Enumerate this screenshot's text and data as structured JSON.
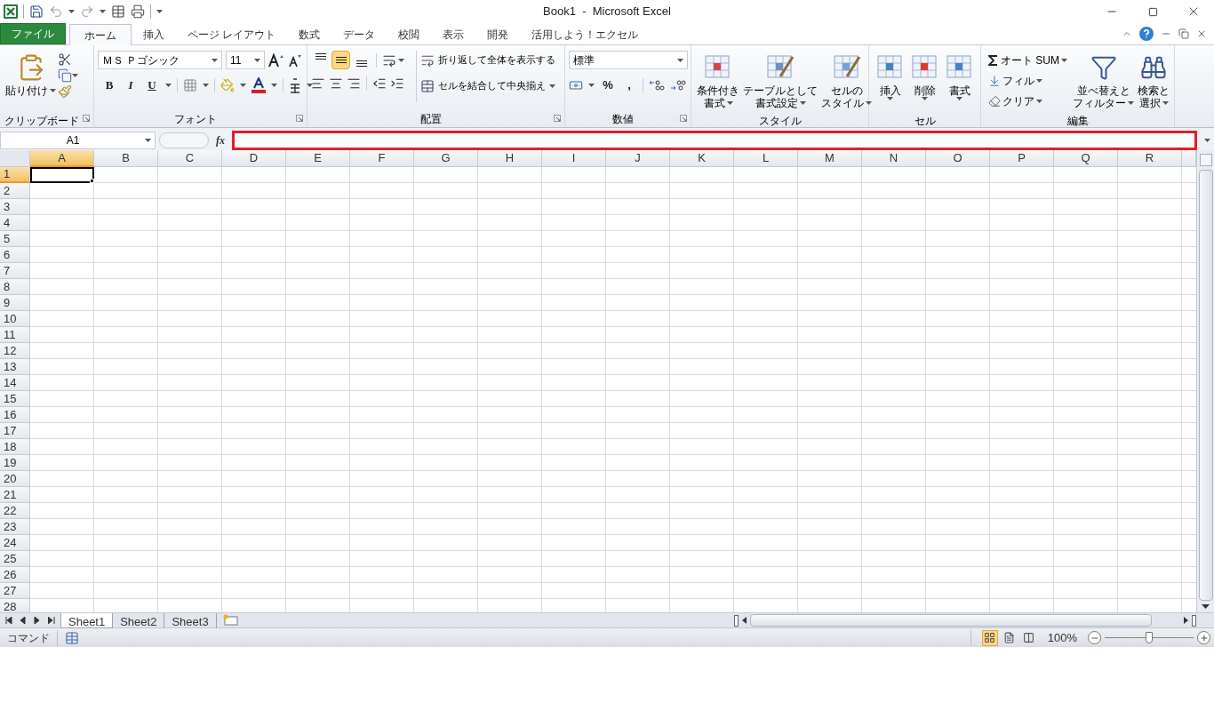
{
  "window": {
    "title": "Book1  -  Microsoft Excel"
  },
  "tabs": [
    {
      "label": "ファイル",
      "kind": "file",
      "selected": false
    },
    {
      "label": "ホーム",
      "kind": "tab",
      "selected": true
    },
    {
      "label": "挿入",
      "kind": "tab",
      "selected": false
    },
    {
      "label": "ページ レイアウト",
      "kind": "tab",
      "selected": false
    },
    {
      "label": "数式",
      "kind": "tab",
      "selected": false
    },
    {
      "label": "データ",
      "kind": "tab",
      "selected": false
    },
    {
      "label": "校閲",
      "kind": "tab",
      "selected": false
    },
    {
      "label": "表示",
      "kind": "tab",
      "selected": false
    },
    {
      "label": "開発",
      "kind": "tab",
      "selected": false
    },
    {
      "label": "活用しよう！エクセル",
      "kind": "tab",
      "selected": false
    }
  ],
  "ribbon": {
    "clipboard": {
      "label": "クリップボード",
      "paste": "貼り付け"
    },
    "font": {
      "label": "フォント",
      "font_name": "ＭＳ Ｐゴシック",
      "font_size": "11",
      "styles": [
        "B",
        "I",
        "U"
      ]
    },
    "alignment": {
      "label": "配置",
      "vertical": [
        {
          "selected": false
        },
        {
          "selected": true
        },
        {
          "selected": false
        }
      ],
      "wrap": "折り返して全体を表示する",
      "merge": "セルを結合して中央揃え"
    },
    "number": {
      "label": "数値",
      "format": "標準",
      "symbols": [
        "%",
        ","
      ]
    },
    "styles": {
      "label": "スタイル",
      "buttons": [
        {
          "lines": [
            "条件付き",
            "書式"
          ],
          "kind": "conditional"
        },
        {
          "lines": [
            "テーブルとして",
            "書式設定"
          ],
          "kind": "table"
        },
        {
          "lines": [
            "セルの",
            "スタイル"
          ],
          "kind": "cellstyle"
        }
      ]
    },
    "cells": {
      "label": "セル",
      "buttons": [
        {
          "label": "挿入",
          "kind": "insert"
        },
        {
          "label": "削除",
          "kind": "delete"
        },
        {
          "label": "書式",
          "kind": "format"
        }
      ]
    },
    "editing": {
      "label": "編集",
      "small": [
        {
          "label": "オート SUM",
          "kind": "sum"
        },
        {
          "label": "フィル",
          "kind": "fill"
        },
        {
          "label": "クリア",
          "kind": "clear"
        }
      ],
      "big": [
        {
          "lines": [
            "並べ替えと",
            "フィルター"
          ],
          "kind": "sort"
        },
        {
          "lines": [
            "検索と",
            "選択"
          ],
          "kind": "find"
        }
      ]
    }
  },
  "formula_bar": {
    "name_box": "A1",
    "fx": "fx",
    "highlighted": true
  },
  "grid": {
    "columns": [
      {
        "label": "A",
        "selected": true
      },
      {
        "label": "B",
        "selected": false
      },
      {
        "label": "C",
        "selected": false
      },
      {
        "label": "D",
        "selected": false
      },
      {
        "label": "E",
        "selected": false
      },
      {
        "label": "F",
        "selected": false
      },
      {
        "label": "G",
        "selected": false
      },
      {
        "label": "H",
        "selected": false
      },
      {
        "label": "I",
        "selected": false
      },
      {
        "label": "J",
        "selected": false
      },
      {
        "label": "K",
        "selected": false
      },
      {
        "label": "L",
        "selected": false
      },
      {
        "label": "M",
        "selected": false
      },
      {
        "label": "N",
        "selected": false
      },
      {
        "label": "O",
        "selected": false
      },
      {
        "label": "P",
        "selected": false
      },
      {
        "label": "Q",
        "selected": false
      },
      {
        "label": "R",
        "selected": false
      }
    ],
    "rows": [
      {
        "label": "1",
        "selected": true
      },
      {
        "label": "2",
        "selected": false
      },
      {
        "label": "3",
        "selected": false
      },
      {
        "label": "4",
        "selected": false
      },
      {
        "label": "5",
        "selected": false
      },
      {
        "label": "6",
        "selected": false
      },
      {
        "label": "7",
        "selected": false
      },
      {
        "label": "8",
        "selected": false
      },
      {
        "label": "9",
        "selected": false
      },
      {
        "label": "10",
        "selected": false
      },
      {
        "label": "11",
        "selected": false
      },
      {
        "label": "12",
        "selected": false
      },
      {
        "label": "13",
        "selected": false
      },
      {
        "label": "14",
        "selected": false
      },
      {
        "label": "15",
        "selected": false
      },
      {
        "label": "16",
        "selected": false
      },
      {
        "label": "17",
        "selected": false
      },
      {
        "label": "18",
        "selected": false
      },
      {
        "label": "19",
        "selected": false
      },
      {
        "label": "20",
        "selected": false
      },
      {
        "label": "21",
        "selected": false
      },
      {
        "label": "22",
        "selected": false
      },
      {
        "label": "23",
        "selected": false
      },
      {
        "label": "24",
        "selected": false
      },
      {
        "label": "25",
        "selected": false
      },
      {
        "label": "26",
        "selected": false
      },
      {
        "label": "27",
        "selected": false
      },
      {
        "label": "28",
        "selected": false
      }
    ]
  },
  "sheet_tabs": [
    {
      "label": "Sheet1",
      "selected": true
    },
    {
      "label": "Sheet2",
      "selected": false
    },
    {
      "label": "Sheet3",
      "selected": false
    }
  ],
  "status_bar": {
    "mode": "コマンド",
    "views": [
      {
        "selected": true
      },
      {
        "selected": false
      },
      {
        "selected": false
      }
    ],
    "zoom": "100%",
    "zoom_slider": {
      "level": 0.5
    }
  }
}
